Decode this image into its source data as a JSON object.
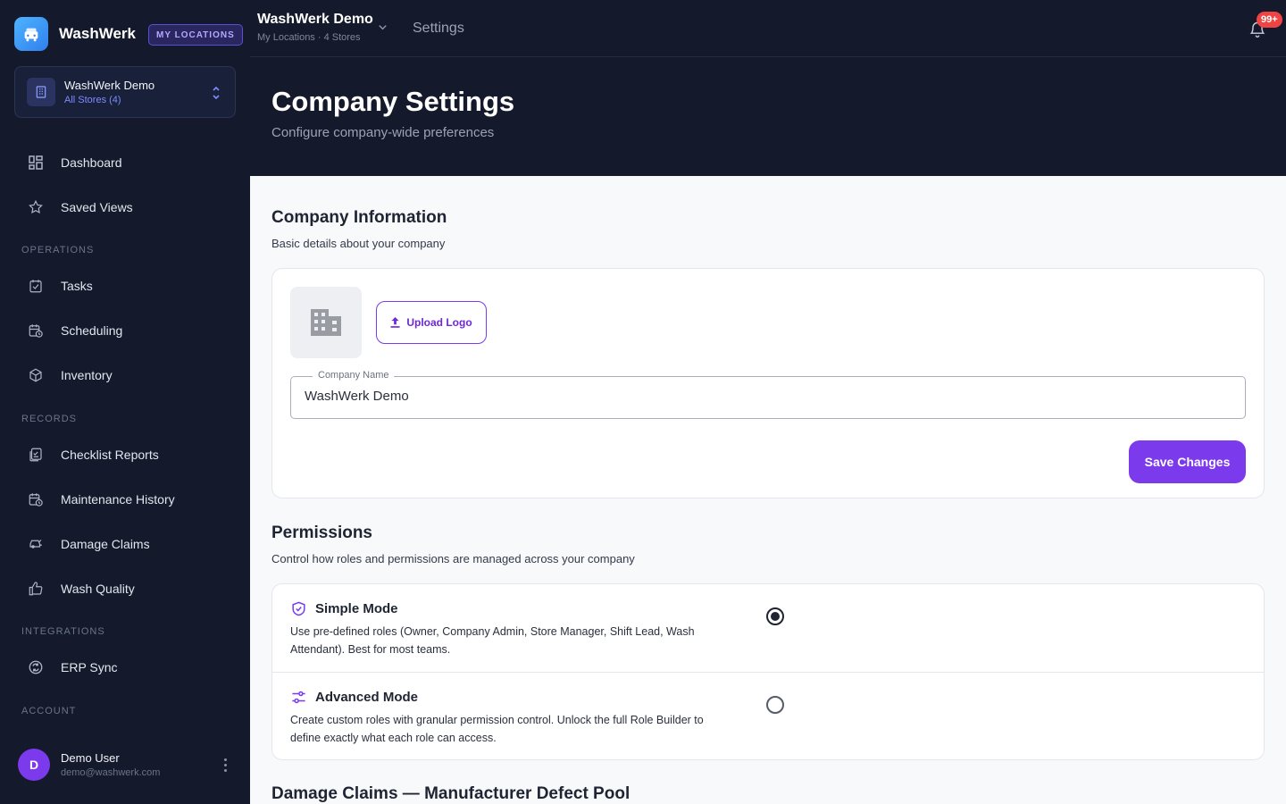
{
  "brand": {
    "name": "WashWerk",
    "locations_badge": "MY LOCATIONS"
  },
  "store_switcher": {
    "name": "WashWerk Demo",
    "sub": "All Stores (4)"
  },
  "nav": {
    "primary": [
      {
        "label": "Dashboard",
        "icon": "dashboard-icon"
      },
      {
        "label": "Saved Views",
        "icon": "star-icon"
      }
    ],
    "sections": [
      {
        "title": "OPERATIONS",
        "items": [
          {
            "label": "Tasks",
            "icon": "clipboard-check-icon"
          },
          {
            "label": "Scheduling",
            "icon": "calendar-clock-icon"
          },
          {
            "label": "Inventory",
            "icon": "box-icon"
          }
        ]
      },
      {
        "title": "RECORDS",
        "items": [
          {
            "label": "Checklist Reports",
            "icon": "checklist-icon"
          },
          {
            "label": "Maintenance History",
            "icon": "calendar-history-icon"
          },
          {
            "label": "Damage Claims",
            "icon": "car-damage-icon"
          },
          {
            "label": "Wash Quality",
            "icon": "thumbs-up-icon"
          }
        ]
      },
      {
        "title": "INTEGRATIONS",
        "items": [
          {
            "label": "ERP Sync",
            "icon": "sync-icon"
          }
        ]
      },
      {
        "title": "ACCOUNT",
        "items": []
      }
    ]
  },
  "user": {
    "initial": "D",
    "name": "Demo User",
    "email": "demo@washwerk.com"
  },
  "topbar": {
    "company": "WashWerk Demo",
    "sub": "My Locations · 4 Stores",
    "page": "Settings",
    "notifications": "99+"
  },
  "header": {
    "title": "Company Settings",
    "subtitle": "Configure company-wide preferences"
  },
  "company_info": {
    "title": "Company Information",
    "subtitle": "Basic details about your company",
    "upload_label": "Upload Logo",
    "name_label": "Company Name",
    "name_value": "WashWerk Demo",
    "save_label": "Save Changes"
  },
  "permissions": {
    "title": "Permissions",
    "subtitle": "Control how roles and permissions are managed across your company",
    "modes": [
      {
        "title": "Simple Mode",
        "desc": "Use pre-defined roles (Owner, Company Admin, Store Manager, Shift Lead, Wash Attendant). Best for most teams.",
        "selected": true
      },
      {
        "title": "Advanced Mode",
        "desc": "Create custom roles with granular permission control. Unlock the full Role Builder to define exactly what each role can access.",
        "selected": false
      }
    ]
  },
  "damage_section": {
    "title": "Damage Claims — Manufacturer Defect Pool"
  },
  "colors": {
    "sidebar_bg": "#141a2b",
    "accent": "#7c3aed",
    "badge": "#ef4444"
  }
}
